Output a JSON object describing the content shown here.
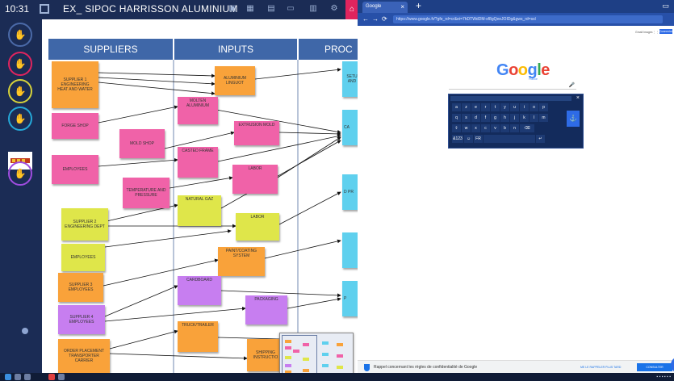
{
  "topbar": {
    "time": "10:31",
    "title": "EX_ SIPOC HARRISSON ALUMINIUM"
  },
  "columns": [
    "SUPPLIERS",
    "INPUTS",
    "PROC"
  ],
  "notes": {
    "supplier1": "SUPPLIER 1\nENGINEERING\nHEAT AND WATER",
    "forge_shop": "FORGE SHOP",
    "mold_shop": "MOLD SHOP",
    "employees1": "EMPLOYEES",
    "temperature": "TEMPERATURE AND PRESSURE",
    "supplier2": "SUPPLIER 2\nENGINEERING DEPT",
    "employees2": "EMPLOYEES",
    "supplier3": "SUPPLIER 3\nEMPLOYEES",
    "supplier4": "SUPPLIER 4\nEMPLOYEES",
    "order_placement": "ORDER PLACEMENT\nTRANSPORTER\nCARRIER",
    "aluminium_linguot": "ALUMINIUM LINGUOT",
    "molten_aluminium": "MOLTEN ALUMINIUM",
    "extrusion_mold": "EXTRUSION MOLD",
    "casted_frame": "CASTED FRAME",
    "labor1": "LABOR",
    "natural_gaz": "NATURAL GAZ",
    "labor2": "LABOR",
    "paint_coating": "PAINT/COATING SYSTEM",
    "cardboard": "CARDBOARD",
    "packaging": "PACKAGING",
    "truck_trailer": "TRUCK/TRAILER",
    "shipping": "SHIPPING INSTRUCTIO",
    "proc_setup": "SETU AND",
    "proc_ca": "CA",
    "proc_d": "D PR",
    "proc_p": "P"
  },
  "browser": {
    "tab_title": "Google",
    "url": "https://www.google.fr/?gfe_rd=cr&ei=7hDTWdDM-sf8gQeeJOIDg&gws_rd=ssl",
    "top_links": [
      "Gmail",
      "Images"
    ],
    "signin_label": "Connexion",
    "logo_letters": [
      "G",
      "o",
      "o",
      "g",
      "l",
      "e"
    ],
    "logo_sub": "France",
    "keyboard_rows": [
      [
        "a",
        "z",
        "e",
        "r",
        "t",
        "y",
        "u",
        "i",
        "o",
        "p"
      ],
      [
        "q",
        "s",
        "d",
        "f",
        "g",
        "h",
        "j",
        "k",
        "l",
        "m"
      ],
      [
        "⇧",
        "w",
        "x",
        "c",
        "v",
        "b",
        "n",
        "⌫"
      ],
      [
        "&123",
        "☺",
        "FR",
        "",
        "↵"
      ]
    ],
    "consent_message": "Rappel concernant les règles de confidentialité de Google",
    "later_label": "ME LE RAPPELER PLUS TARD",
    "review_label": "CONSULTER MAINTENANT"
  },
  "colors": {
    "orange": "#f9a23a",
    "pink": "#f062a8",
    "yellow": "#dfe64a",
    "cyan": "#5fd0ee",
    "violet": "#c77ef0",
    "header_blue": "#3f67a8"
  }
}
